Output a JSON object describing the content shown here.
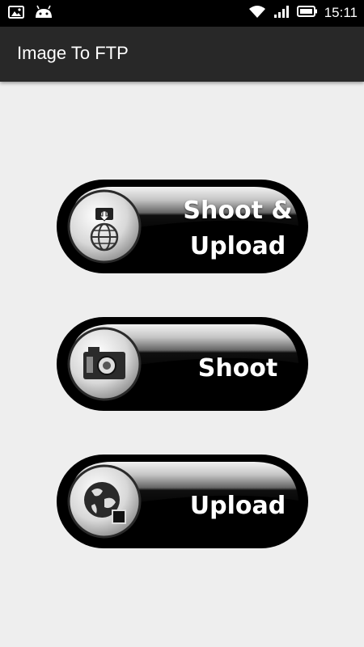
{
  "status_bar": {
    "time": "15:11",
    "left_icons": [
      "image-icon",
      "android-icon"
    ],
    "right_icons": [
      "wifi-icon",
      "signal-icon",
      "battery-icon"
    ]
  },
  "app_bar": {
    "title": "Image To FTP"
  },
  "buttons": [
    {
      "line1": "Shoot &",
      "line2": "Upload",
      "icon": "camera-globe-upload-icon"
    },
    {
      "label": "Shoot",
      "icon": "camera-icon"
    },
    {
      "label": "Upload",
      "icon": "globe-upload-icon"
    }
  ],
  "colors": {
    "background": "#eeeeee",
    "status_bar": "#000000",
    "app_bar": "#282828",
    "button_dark": "#000000",
    "button_light": "#f4f4f4",
    "text": "#ffffff"
  }
}
